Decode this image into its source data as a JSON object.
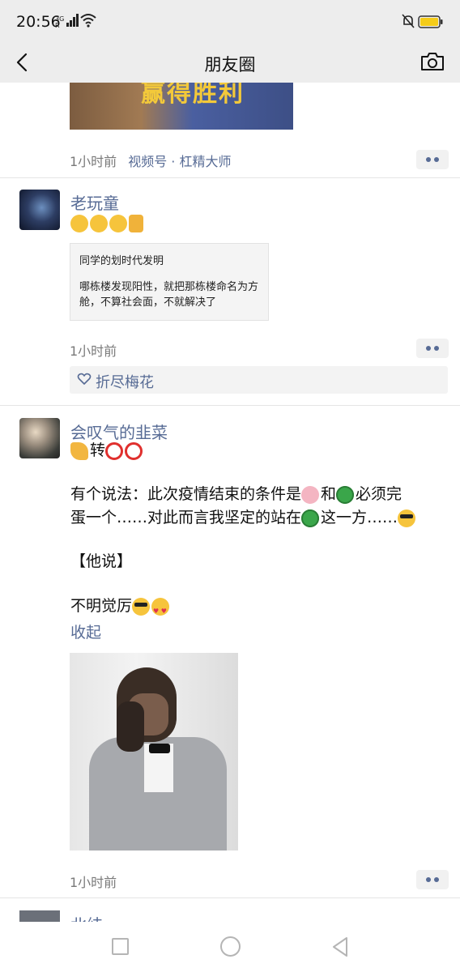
{
  "status": {
    "time": "20:56",
    "network": "3G",
    "network_sub": "R"
  },
  "header": {
    "title": "朋友圈"
  },
  "colors": {
    "link": "#576b95",
    "bar_bg": "#ededed",
    "battery": "#f5cc19"
  },
  "posts": [
    {
      "time": "1小时前",
      "source": "视频号 · 杠精大师",
      "thumbnail_text": "赢得胜利"
    },
    {
      "username": "老玩童",
      "quote": {
        "title": "同学的划时代发明",
        "body": "哪栋楼发现阳性，就把那栋楼命名为方舱，不算社会面，不就解决了"
      },
      "time": "1小时前",
      "likes": "折尽梅花"
    },
    {
      "username": "会叹气的韭菜",
      "line1": "转",
      "line2_a": "有个说法：此次疫情结束的条件是",
      "line2_b": "和",
      "line2_c": "必须完",
      "line3_a": "蛋一个……对此而言我坚定的站在",
      "line3_b": "这一方……",
      "line4": "【他说】",
      "line5": "不明觉厉",
      "collapse": "收起",
      "time": "1小时前"
    },
    {
      "username": "北纬"
    }
  ]
}
